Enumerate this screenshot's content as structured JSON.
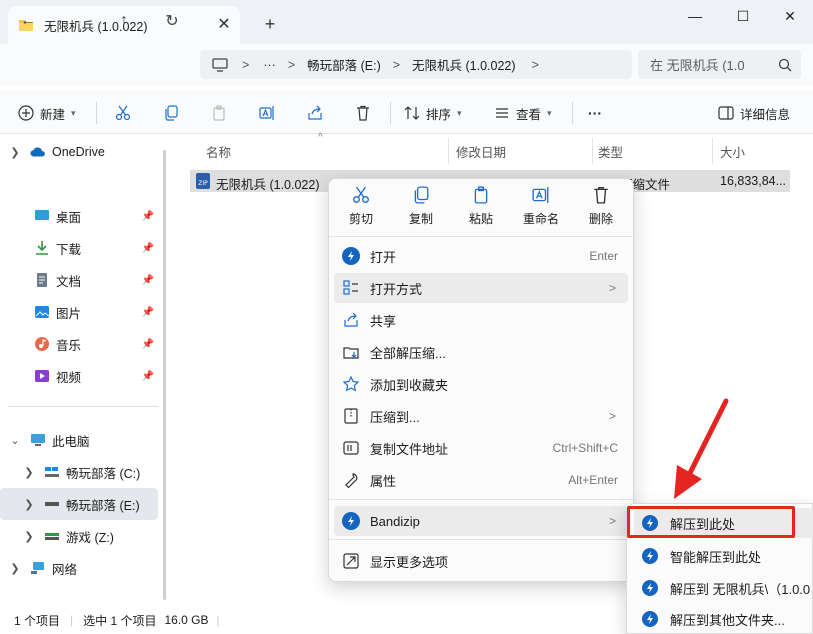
{
  "window": {
    "tab_title": "无限机兵 (1.0.022)",
    "tab_close": "✕",
    "new_tab": "+",
    "minimize": "—",
    "maximize": "☐",
    "close": "✕"
  },
  "nav": {
    "address": {
      "more": "···",
      "segments": [
        "畅玩部落 (E:)",
        "无限机兵 (1.0.022)"
      ],
      "sep": ">"
    },
    "search_placeholder": "在 无限机兵 (1.0"
  },
  "toolbar": {
    "new_label": "新建",
    "sort_label": "排序",
    "view_label": "查看",
    "more": "···",
    "details_label": "详细信息"
  },
  "sidebar": {
    "onedrive": "OneDrive",
    "quick": [
      {
        "label": "桌面",
        "icon": "desktop-icon",
        "color": "#2aa0d8"
      },
      {
        "label": "下载",
        "icon": "download-icon",
        "color": "#2a9a3b"
      },
      {
        "label": "文档",
        "icon": "document-icon",
        "color": "#6a7a8c"
      },
      {
        "label": "图片",
        "icon": "pictures-icon",
        "color": "#1e88e5"
      },
      {
        "label": "音乐",
        "icon": "music-icon",
        "color": "#e86a4b"
      },
      {
        "label": "视频",
        "icon": "video-icon",
        "color": "#8a3ed0"
      }
    ],
    "this_pc": "此电脑",
    "drives": [
      {
        "label": "畅玩部落 (C:)"
      },
      {
        "label": "畅玩部落 (E:)"
      },
      {
        "label": "游戏 (Z:)"
      }
    ],
    "network": "网络"
  },
  "filelist": {
    "columns": {
      "name": "名称",
      "modified": "修改日期",
      "type": "类型",
      "size": "大小"
    },
    "rows": [
      {
        "name": "无限机兵 (1.0.022)",
        "type": "压缩文件",
        "size": "16,833,84..."
      }
    ]
  },
  "context_menu": {
    "top": [
      {
        "label": "剪切",
        "icon": "cut-icon"
      },
      {
        "label": "复制",
        "icon": "copy-icon"
      },
      {
        "label": "粘贴",
        "icon": "paste-icon"
      },
      {
        "label": "重命名",
        "icon": "rename-icon"
      },
      {
        "label": "删除",
        "icon": "delete-icon"
      }
    ],
    "items": [
      {
        "label": "打开",
        "shortcut": "Enter",
        "icon": "bandizip-icon"
      },
      {
        "label": "打开方式",
        "icon": "open-with-icon",
        "submenu": true
      },
      {
        "label": "共享",
        "icon": "share-icon"
      },
      {
        "label": "全部解压缩...",
        "icon": "extract-all-icon"
      },
      {
        "label": "添加到收藏夹",
        "icon": "star-icon"
      },
      {
        "label": "压缩到...",
        "icon": "compress-icon",
        "submenu": true
      },
      {
        "label": "复制文件地址",
        "shortcut": "Ctrl+Shift+C",
        "icon": "copy-path-icon"
      },
      {
        "label": "属性",
        "shortcut": "Alt+Enter",
        "icon": "properties-icon"
      },
      {
        "label": "Bandizip",
        "icon": "bandizip-icon",
        "submenu": true
      },
      {
        "label": "显示更多选项",
        "icon": "more-options-icon"
      }
    ],
    "arrow": ">"
  },
  "submenu": [
    {
      "label": "解压到此处"
    },
    {
      "label": "智能解压到此处"
    },
    {
      "label": "解压到 无限机兵\\（1.0.0"
    },
    {
      "label": "解压到其他文件夹..."
    }
  ],
  "status": {
    "count": "1 个项目",
    "selected": "选中 1 个项目",
    "size": "16.0 GB"
  },
  "colors": {
    "accent": "#1565c0",
    "highlight_box": "#e52521",
    "annotation_arrow": "#e52521"
  }
}
